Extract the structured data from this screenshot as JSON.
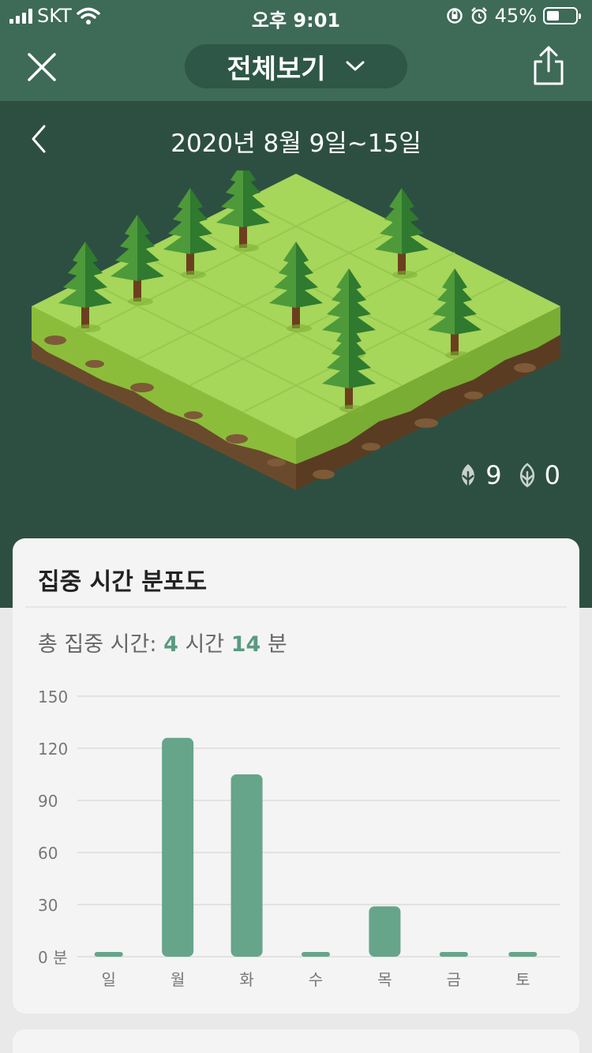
{
  "status_bar": {
    "carrier": "SKT",
    "time": "오후 9:01",
    "battery_text": "45%",
    "battery_level": 0.45
  },
  "nav": {
    "title": "전체보기"
  },
  "hero": {
    "date_range": "2020년 8월 9일~15일",
    "healthy_trees": "9",
    "dead_trees": "0"
  },
  "card": {
    "title": "집중 시간 분포도",
    "total_prefix": "총 집중 시간:",
    "total_hours": "4",
    "hours_unit": "시간",
    "total_minutes": "14",
    "minutes_unit": "분"
  },
  "colors": {
    "header_green": "#3e6a58",
    "hero_green": "#2d4f42",
    "bar_green": "#66a58a",
    "accent_text": "#5a9a80"
  },
  "chart_data": {
    "type": "bar",
    "categories": [
      "일",
      "월",
      "화",
      "수",
      "목",
      "금",
      "토"
    ],
    "values": [
      0,
      126,
      105,
      0,
      29,
      0,
      0
    ],
    "yticks": [
      "0 분",
      "30",
      "60",
      "90",
      "120",
      "150"
    ],
    "ylim": [
      0,
      150
    ],
    "grid": true
  }
}
